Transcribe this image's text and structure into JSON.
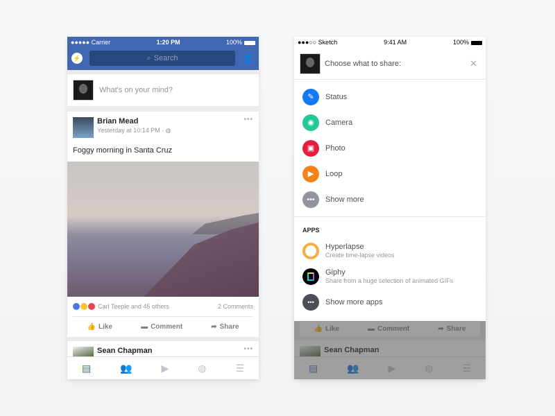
{
  "left": {
    "statusbar": {
      "signal": "●●●●● Carrier",
      "time": "1:20 PM",
      "battery": "100%"
    },
    "header": {
      "messenger_icon": "messenger-icon",
      "search_placeholder": "Search",
      "friends_icon": "friend-requests-icon"
    },
    "composer": {
      "placeholder": "What's on your mind?"
    },
    "post": {
      "author": "Brian Mead",
      "timestamp": "Yesterday at 10:14 PM · ",
      "privacy_icon": "globe-icon",
      "text": "Foggy morning in Santa Cruz",
      "reactions_text": "Carl Teeple and 45 others",
      "comments": "2 Comments",
      "actions": {
        "like": "Like",
        "comment": "Comment",
        "share": "Share"
      }
    },
    "next_post": {
      "author": "Sean Chapman"
    },
    "tabbar": [
      "news-feed-icon",
      "friends-icon",
      "video-icon",
      "globe-icon",
      "menu-icon"
    ]
  },
  "right": {
    "statusbar": {
      "signal": "●●●○○ Sketch",
      "time": "9:41 AM",
      "battery": "100%"
    },
    "sheet": {
      "title": "Choose what to share:",
      "options": [
        {
          "label": "Status",
          "icon": "pencil-icon",
          "color": "#1877f2"
        },
        {
          "label": "Camera",
          "icon": "camera-icon",
          "color": "#20c997"
        },
        {
          "label": "Photo",
          "icon": "photo-icon",
          "color": "#e41e3f"
        },
        {
          "label": "Loop",
          "icon": "loop-icon",
          "color": "#f7821b"
        },
        {
          "label": "Show more",
          "icon": "more-icon",
          "color": "#90949c"
        }
      ],
      "apps_header": "APPS",
      "apps": [
        {
          "name": "Hyperlapse",
          "subtitle": "Create time-lapse videos"
        },
        {
          "name": "Giphy",
          "subtitle": "Share from a huge selection of animated GIFs"
        },
        {
          "name": "Show more apps",
          "subtitle": ""
        }
      ]
    },
    "background": {
      "actions": {
        "like": "Like",
        "comment": "Comment",
        "share": "Share"
      },
      "next_post": "Sean Chapman"
    }
  }
}
